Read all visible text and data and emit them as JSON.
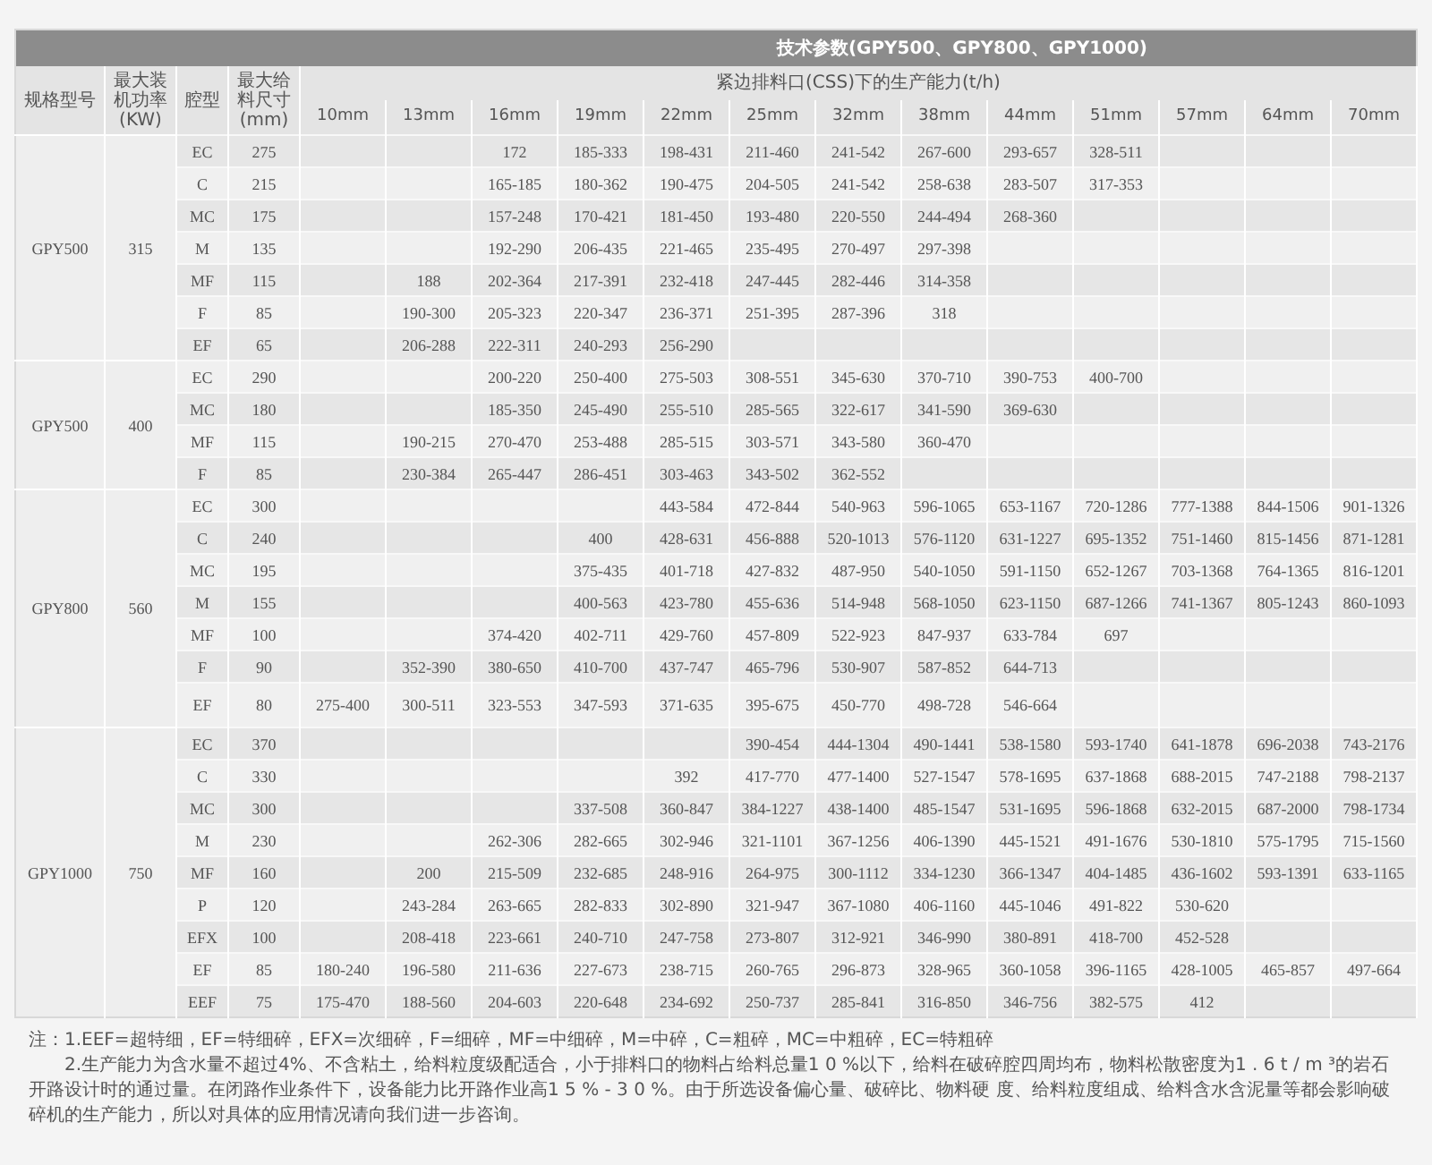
{
  "table": {
    "title": "技术参数(GPY500、GPY800、GPY1000)",
    "columns": {
      "model": "规格型号",
      "power": "最大装机功率(KW)",
      "cavity": "腔型",
      "feed": "最大给料尺寸(mm)",
      "capacity": "紧边排料口(CSS)下的生产能力(t/h)",
      "sizes": [
        "10mm",
        "13mm",
        "16mm",
        "19mm",
        "22mm",
        "25mm",
        "32mm",
        "38mm",
        "44mm",
        "51mm",
        "57mm",
        "64mm",
        "70mm"
      ]
    },
    "groups": [
      {
        "model": "GPY500",
        "power": "315",
        "rows": [
          {
            "cavity": "EC",
            "feed": "275",
            "cells": [
              null,
              null,
              "172",
              "185-333",
              "198-431",
              "211-460",
              "241-542",
              "267-600",
              "293-657",
              "328-511",
              null,
              null,
              null
            ]
          },
          {
            "cavity": "C",
            "feed": "215",
            "cells": [
              null,
              null,
              "165-185",
              "180-362",
              "190-475",
              "204-505",
              "241-542",
              "258-638",
              "283-507",
              "317-353",
              null,
              null,
              null
            ]
          },
          {
            "cavity": "MC",
            "feed": "175",
            "cells": [
              null,
              null,
              "157-248",
              "170-421",
              "181-450",
              "193-480",
              "220-550",
              "244-494",
              "268-360",
              null,
              null,
              null,
              null
            ]
          },
          {
            "cavity": "M",
            "feed": "135",
            "cells": [
              null,
              null,
              "192-290",
              "206-435",
              "221-465",
              "235-495",
              "270-497",
              "297-398",
              null,
              null,
              null,
              null,
              null
            ]
          },
          {
            "cavity": "MF",
            "feed": "115",
            "cells": [
              null,
              "188",
              "202-364",
              "217-391",
              "232-418",
              "247-445",
              "282-446",
              "314-358",
              null,
              null,
              null,
              null,
              null
            ]
          },
          {
            "cavity": "F",
            "feed": "85",
            "cells": [
              null,
              "190-300",
              "205-323",
              "220-347",
              "236-371",
              "251-395",
              "287-396",
              "318",
              null,
              null,
              null,
              null,
              null
            ]
          },
          {
            "cavity": "EF",
            "feed": "65",
            "cells": [
              null,
              "206-288",
              "222-311",
              "240-293",
              "256-290",
              null,
              null,
              null,
              null,
              null,
              null,
              null,
              null
            ]
          }
        ]
      },
      {
        "model": "GPY500",
        "power": "400",
        "rows": [
          {
            "cavity": "EC",
            "feed": "290",
            "cells": [
              null,
              null,
              "200-220",
              "250-400",
              "275-503",
              "308-551",
              "345-630",
              "370-710",
              "390-753",
              "400-700",
              null,
              null,
              null
            ]
          },
          {
            "cavity": "MC",
            "feed": "180",
            "cells": [
              null,
              null,
              "185-350",
              "245-490",
              "255-510",
              "285-565",
              "322-617",
              "341-590",
              "369-630",
              null,
              null,
              null,
              null
            ]
          },
          {
            "cavity": "MF",
            "feed": "115",
            "cells": [
              null,
              "190-215",
              "270-470",
              "253-488",
              "285-515",
              "303-571",
              "343-580",
              "360-470",
              null,
              null,
              null,
              null,
              null
            ]
          },
          {
            "cavity": "F",
            "feed": "85",
            "cells": [
              null,
              "230-384",
              "265-447",
              "286-451",
              "303-463",
              "343-502",
              "362-552",
              null,
              null,
              null,
              null,
              null,
              null
            ]
          }
        ]
      },
      {
        "model": "GPY800",
        "power": "560",
        "rows": [
          {
            "cavity": "EC",
            "feed": "300",
            "cells": [
              null,
              null,
              null,
              null,
              "443-584",
              "472-844",
              "540-963",
              "596-1065",
              "653-1167",
              "720-1286",
              "777-1388",
              "844-1506",
              "901-1326"
            ]
          },
          {
            "cavity": "C",
            "feed": "240",
            "cells": [
              null,
              null,
              null,
              "400",
              "428-631",
              "456-888",
              "520-1013",
              "576-1120",
              "631-1227",
              "695-1352",
              "751-1460",
              "815-1456",
              "871-1281"
            ]
          },
          {
            "cavity": "MC",
            "feed": "195",
            "cells": [
              null,
              null,
              null,
              "375-435",
              "401-718",
              "427-832",
              "487-950",
              "540-1050",
              "591-1150",
              "652-1267",
              "703-1368",
              "764-1365",
              "816-1201"
            ]
          },
          {
            "cavity": "M",
            "feed": "155",
            "cells": [
              null,
              null,
              null,
              "400-563",
              "423-780",
              "455-636",
              "514-948",
              "568-1050",
              "623-1150",
              "687-1266",
              "741-1367",
              "805-1243",
              "860-1093"
            ]
          },
          {
            "cavity": "MF",
            "feed": "100",
            "cells": [
              null,
              null,
              "374-420",
              "402-711",
              "429-760",
              "457-809",
              "522-923",
              "847-937",
              "633-784",
              "697",
              null,
              null,
              null
            ]
          },
          {
            "cavity": "F",
            "feed": "90",
            "cells": [
              null,
              "352-390",
              "380-650",
              "410-700",
              "437-747",
              "465-796",
              "530-907",
              "587-852",
              "644-713",
              null,
              null,
              null,
              null
            ]
          },
          {
            "cavity": "EF",
            "feed": "80",
            "cells": [
              "275-400",
              "300-511",
              "323-553",
              "347-593",
              "371-635",
              "395-675",
              "450-770",
              "498-728",
              "546-664",
              null,
              null,
              null,
              null
            ]
          }
        ]
      },
      {
        "model": "GPY1000",
        "power": "750",
        "rows": [
          {
            "cavity": "EC",
            "feed": "370",
            "cells": [
              null,
              null,
              null,
              null,
              null,
              "390-454",
              "444-1304",
              "490-1441",
              "538-1580",
              "593-1740",
              "641-1878",
              "696-2038",
              "743-2176"
            ]
          },
          {
            "cavity": "C",
            "feed": "330",
            "cells": [
              null,
              null,
              null,
              null,
              "392",
              "417-770",
              "477-1400",
              "527-1547",
              "578-1695",
              "637-1868",
              "688-2015",
              "747-2188",
              "798-2137"
            ]
          },
          {
            "cavity": "MC",
            "feed": "300",
            "cells": [
              null,
              null,
              null,
              "337-508",
              "360-847",
              "384-1227",
              "438-1400",
              "485-1547",
              "531-1695",
              "596-1868",
              "632-2015",
              "687-2000",
              "798-1734"
            ]
          },
          {
            "cavity": "M",
            "feed": "230",
            "cells": [
              null,
              null,
              "262-306",
              "282-665",
              "302-946",
              "321-1101",
              "367-1256",
              "406-1390",
              "445-1521",
              "491-1676",
              "530-1810",
              "575-1795",
              "715-1560"
            ]
          },
          {
            "cavity": "MF",
            "feed": "160",
            "cells": [
              null,
              "200",
              "215-509",
              "232-685",
              "248-916",
              "264-975",
              "300-1112",
              "334-1230",
              "366-1347",
              "404-1485",
              "436-1602",
              "593-1391",
              "633-1165"
            ]
          },
          {
            "cavity": "P",
            "feed": "120",
            "cells": [
              null,
              "243-284",
              "263-665",
              "282-833",
              "302-890",
              "321-947",
              "367-1080",
              "406-1160",
              "445-1046",
              "491-822",
              "530-620",
              null,
              null
            ]
          },
          {
            "cavity": "EFX",
            "feed": "100",
            "cells": [
              null,
              "208-418",
              "223-661",
              "240-710",
              "247-758",
              "273-807",
              "312-921",
              "346-990",
              "380-891",
              "418-700",
              "452-528",
              null,
              null
            ]
          },
          {
            "cavity": "EF",
            "feed": "85",
            "cells": [
              "180-240",
              "196-580",
              "211-636",
              "227-673",
              "238-715",
              "260-765",
              "296-873",
              "328-965",
              "360-1058",
              "396-1165",
              "428-1005",
              "465-857",
              "497-664"
            ]
          },
          {
            "cavity": "EEF",
            "feed": "75",
            "cells": [
              "175-470",
              "188-560",
              "204-603",
              "220-648",
              "234-692",
              "250-737",
              "285-841",
              "316-850",
              "346-756",
              "382-575",
              "412",
              null,
              null
            ]
          }
        ]
      }
    ]
  },
  "notes": [
    "注：1.EEF=超特细，EF=特细碎，EFX=次细碎，F=细碎，MF=中细碎，M=中碎，C=粗碎，MC=中粗碎，EC=特粗碎",
    "2.生产能力为含水量不超过4%、不含粘土，给料粒度级配适合，小于排料口的物料占给料总量1 0 %以下，给料在破碎腔四周均布，物料松散密度为1 . 6 t / m ³的岩石开路设计时的通过量。在闭路作业条件下，设备能力比开路作业高1 5 % - 3 0 %。由于所选设备偏心量、破碎比、物料硬 度、给料粒度组成、给料含水含泥量等都会影响破碎机的生产能力，所以对具体的应用情况请向我们进一步咨询。"
  ]
}
